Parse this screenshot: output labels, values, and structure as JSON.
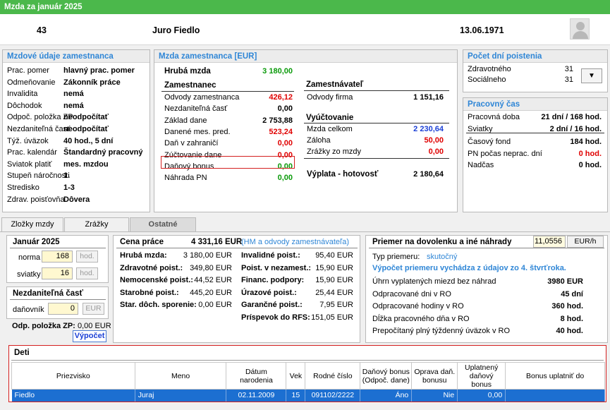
{
  "title": "Mzda za január 2025",
  "header": {
    "id": "43",
    "name": "Juro Fiedlo",
    "date": "13.06.1971"
  },
  "mzdove": {
    "title": "Mzdové údaje zamestnanca",
    "rows": [
      {
        "label": "Prac. pomer",
        "value": "hlavný prac. pomer"
      },
      {
        "label": "Odmeňovanie",
        "value": "Zákonník práce"
      },
      {
        "label": "Invalidita",
        "value": "nemá"
      },
      {
        "label": "Dôchodok",
        "value": "nemá"
      },
      {
        "label": "Odpoč. položka ZP",
        "value": "neodpočítať"
      },
      {
        "label": "Nezdaniteľná časť",
        "value": "neodpočítať"
      },
      {
        "label": "Týž. úväzok",
        "value": "40 hod., 5 dní"
      },
      {
        "label": "Prac. kalendár",
        "value": "Štandardný pracovný"
      },
      {
        "label": "Sviatok platiť",
        "value": "mes. mzdou"
      },
      {
        "label": "Stupeň náročnosti",
        "value": "1."
      },
      {
        "label": "Stredisko",
        "value": "1-3"
      },
      {
        "label": "Zdrav. poisťovňa",
        "value": "Dôvera"
      }
    ]
  },
  "mzda": {
    "title": "Mzda zamestnanca [EUR]",
    "hruba_label": "Hrubá mzda",
    "hruba_value": "3 180,00",
    "zamestnanec_title": "Zamestnanec",
    "zamestnanec": [
      {
        "label": "Odvody zamestnanca",
        "value": "426,12"
      },
      {
        "label": "Nezdaniteľná časť",
        "value": "0,00"
      },
      {
        "label": "Základ dane",
        "value": "2 753,88"
      },
      {
        "label": "Danené mes. pred.",
        "value": "523,24"
      },
      {
        "label": "Daň v zahraničí",
        "value": "0,00"
      },
      {
        "label": "Zúčtovanie dane",
        "value": "0,00"
      },
      {
        "label": "Daňový bonus",
        "value": "0,00"
      },
      {
        "label": "Náhrada PN",
        "value": "0,00"
      }
    ],
    "zamestnavatel_title": "Zamestnávateľ",
    "odvody_firma_label": "Odvody firma",
    "odvody_firma_value": "1 151,16",
    "vyuctovanie_title": "Vyúčtovanie",
    "vyuctovanie": [
      {
        "label": "Mzda celkom",
        "value": "2 230,64"
      },
      {
        "label": "Záloha",
        "value": "50,00"
      },
      {
        "label": "Zrážky zo mzdy",
        "value": "0,00"
      }
    ],
    "vyplata_label": "Výplata - hotovosť",
    "vyplata_value": "2 180,64"
  },
  "poistenia": {
    "title": "Počet dní poistenia",
    "rows": [
      {
        "label": "Zdravotného",
        "value": "31"
      },
      {
        "label": "Sociálneho",
        "value": "31"
      }
    ]
  },
  "pracovny": {
    "title": "Pracovný čas",
    "rows": [
      {
        "label": "Pracovná doba",
        "value": "21 dní / 168 hod."
      },
      {
        "label": "Sviatky",
        "value": "2 dní / 16 hod."
      },
      {
        "label": "Časový fond",
        "value": "184 hod."
      },
      {
        "label": "PN počas neprac. dní",
        "value": "0 hod."
      },
      {
        "label": "Nadčas",
        "value": "0 hod."
      }
    ]
  },
  "tabs": [
    "Zložky mzdy",
    "Zrážky",
    "Ostatné"
  ],
  "januar": {
    "title": "Január 2025",
    "norma_label": "norma",
    "norma_value": "168",
    "sviatky_label": "sviatky",
    "sviatky_value": "16",
    "hod": "hod."
  },
  "nezd": {
    "title": "Nezdaniteľná časť",
    "danovnik_label": "daňovník",
    "danovnik_value": "0",
    "eur": "EUR",
    "odp_label": "Odp. položka ZP:",
    "odp_value": "0,00 EUR",
    "vypocet": "Výpočet"
  },
  "cena": {
    "title": "Cena práce",
    "total": "4 331,16 EUR",
    "note": "(HM a odvody zamestnávateľa)",
    "left": [
      {
        "label": "Hrubá mzda:",
        "value": "3 180,00 EUR"
      },
      {
        "label": "Zdravotné poist.:",
        "value": "349,80 EUR"
      },
      {
        "label": "Nemocenské poist.:",
        "value": "44,52 EUR"
      },
      {
        "label": "Starobné poist.:",
        "value": "445,20 EUR"
      },
      {
        "label": "Star. dôch. sporenie:",
        "value": "0,00 EUR"
      }
    ],
    "right": [
      {
        "label": "Invalidné poist.:",
        "value": "95,40 EUR"
      },
      {
        "label": "Poist. v nezamest.:",
        "value": "15,90 EUR"
      },
      {
        "label": "Financ. podpory:",
        "value": "15,90 EUR"
      },
      {
        "label": "Úrazové poist.:",
        "value": "25,44 EUR"
      },
      {
        "label": "Garančné poist.:",
        "value": "7,95 EUR"
      },
      {
        "label": "Príspevok do RFS:",
        "value": "151,05 EUR"
      }
    ]
  },
  "priemer": {
    "title": "Priemer na dovolenku a iné náhrady",
    "rate": "11,0556",
    "rate_unit": "EUR/h",
    "typ_label": "Typ priemeru:",
    "typ_value": "skutočný",
    "info": "Výpočet priemeru vychádza z údajov zo 4. štvrťroka.",
    "rows": [
      {
        "label": "Úhrn vyplatených miezd bez náhrad",
        "value": "3980 EUR"
      },
      {
        "label": "Odpracované dni v RO",
        "value": "45 dní"
      },
      {
        "label": "Odpracované hodiny v RO",
        "value": "360 hod."
      },
      {
        "label": "Dĺžka pracovného dňa v RO",
        "value": "8 hod."
      },
      {
        "label": "Prepočítaný plný týždenný úväzok v RO",
        "value": "40 hod."
      }
    ]
  },
  "deti": {
    "title": "Deti",
    "columns": [
      "Priezvisko",
      "Meno",
      "Dátum narodenia",
      "Vek",
      "Rodné číslo",
      "Daňový bonus (Odpoč. dane)",
      "Oprava daň. bonusu",
      "Uplatnený daňový bonus",
      "Bonus uplatniť do"
    ],
    "row": [
      "Fiedlo",
      "Juraj",
      "02.11.2009",
      "15",
      "091102/2222",
      "Áno",
      "Nie",
      "0,00",
      ""
    ]
  },
  "colors": {
    "title_bar": "#4bb84b",
    "section_title": "#2f86d6",
    "negative": "#e00000",
    "positive": "#0a9a0a",
    "selection": "#1c6fd1"
  }
}
